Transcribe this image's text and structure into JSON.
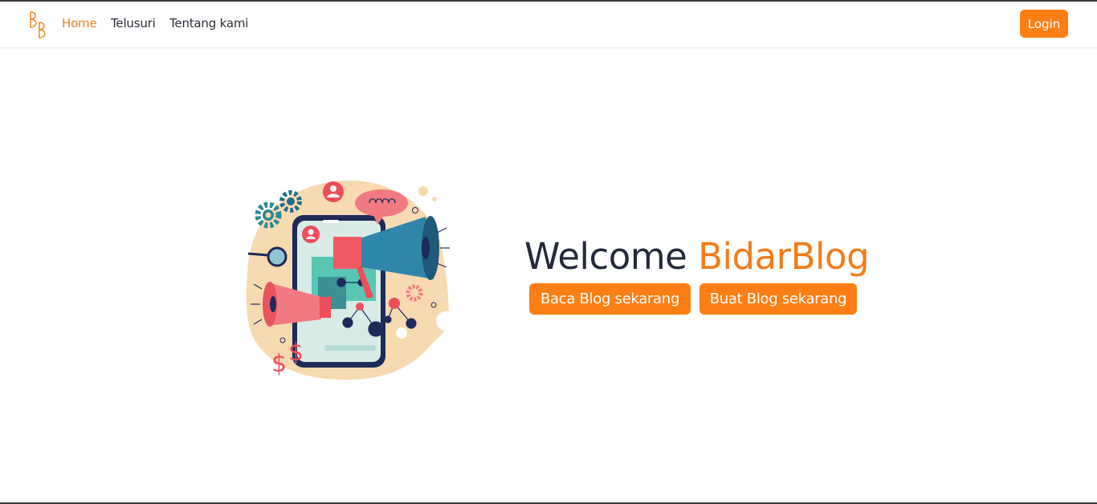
{
  "navbar": {
    "logo_icon": "bb-monogram-logo",
    "links": [
      {
        "label": "Home",
        "active": true
      },
      {
        "label": "Telusuri",
        "active": false
      },
      {
        "label": "Tentang kami",
        "active": false
      }
    ],
    "login_label": "Login"
  },
  "hero": {
    "illustration_icon": "megaphone-smartphone-illustration",
    "welcome_text": "Welcome",
    "brand_text": "BidarBlog",
    "read_button_label": "Baca Blog sekarang",
    "write_button_label": "Buat Blog sekarang"
  },
  "colors": {
    "accent": "#fd7e14",
    "brand_text": "#f27c1b",
    "heading_text": "#232a39",
    "nav_text": "#2b2f3a"
  }
}
